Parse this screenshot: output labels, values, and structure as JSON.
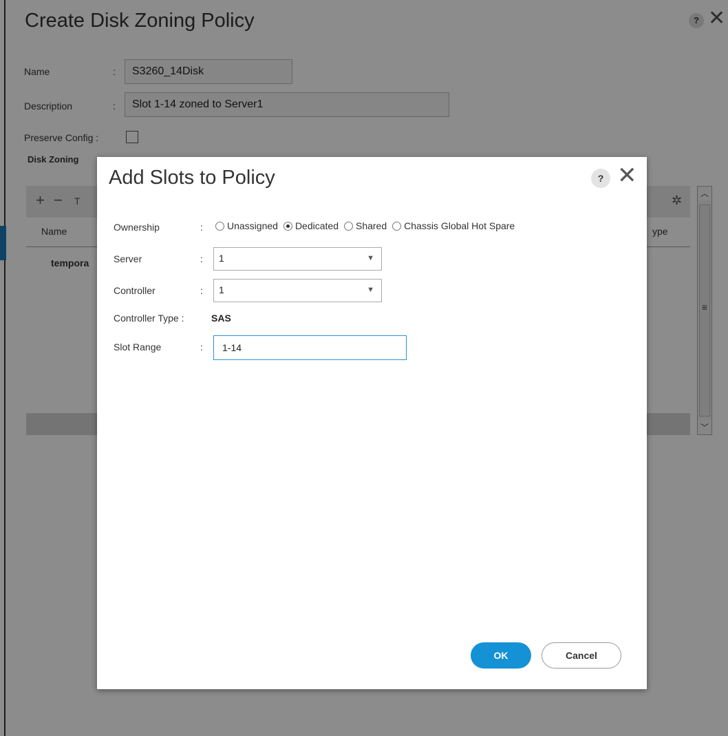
{
  "background_dialog": {
    "title": "Create Disk Zoning Policy",
    "help_label": "?",
    "close_label": "✕",
    "fields": {
      "name_label": "Name",
      "name_value": "S3260_14Disk",
      "description_label": "Description",
      "description_value": "Slot 1-14 zoned to Server1",
      "preserve_config_label": "Preserve Config :",
      "colon": ":"
    },
    "section_label": "Disk Zoning",
    "table": {
      "add_label": "+",
      "remove_label": "−",
      "filter_label": "T",
      "settings_icon": "gear-icon",
      "column_name": "Name",
      "column_type_partial": "ype",
      "row_partial": "tempora"
    }
  },
  "modal": {
    "title": "Add Slots to Policy",
    "help_label": "?",
    "close_label": "✕",
    "ownership": {
      "label": "Ownership",
      "options": [
        {
          "label": "Unassigned",
          "checked": false
        },
        {
          "label": "Dedicated",
          "checked": true
        },
        {
          "label": "Shared",
          "checked": false
        },
        {
          "label": "Chassis Global Hot Spare",
          "checked": false
        }
      ]
    },
    "server": {
      "label": "Server",
      "value": "1"
    },
    "controller": {
      "label": "Controller",
      "value": "1"
    },
    "controller_type": {
      "label": "Controller Type :",
      "value": "SAS"
    },
    "slot_range": {
      "label": "Slot Range",
      "value": "1-14"
    },
    "colon": ":",
    "ok_label": "OK",
    "cancel_label": "Cancel"
  },
  "colors": {
    "accent": "#1591d6",
    "overlay": "rgba(0,0,0,0.45)"
  }
}
